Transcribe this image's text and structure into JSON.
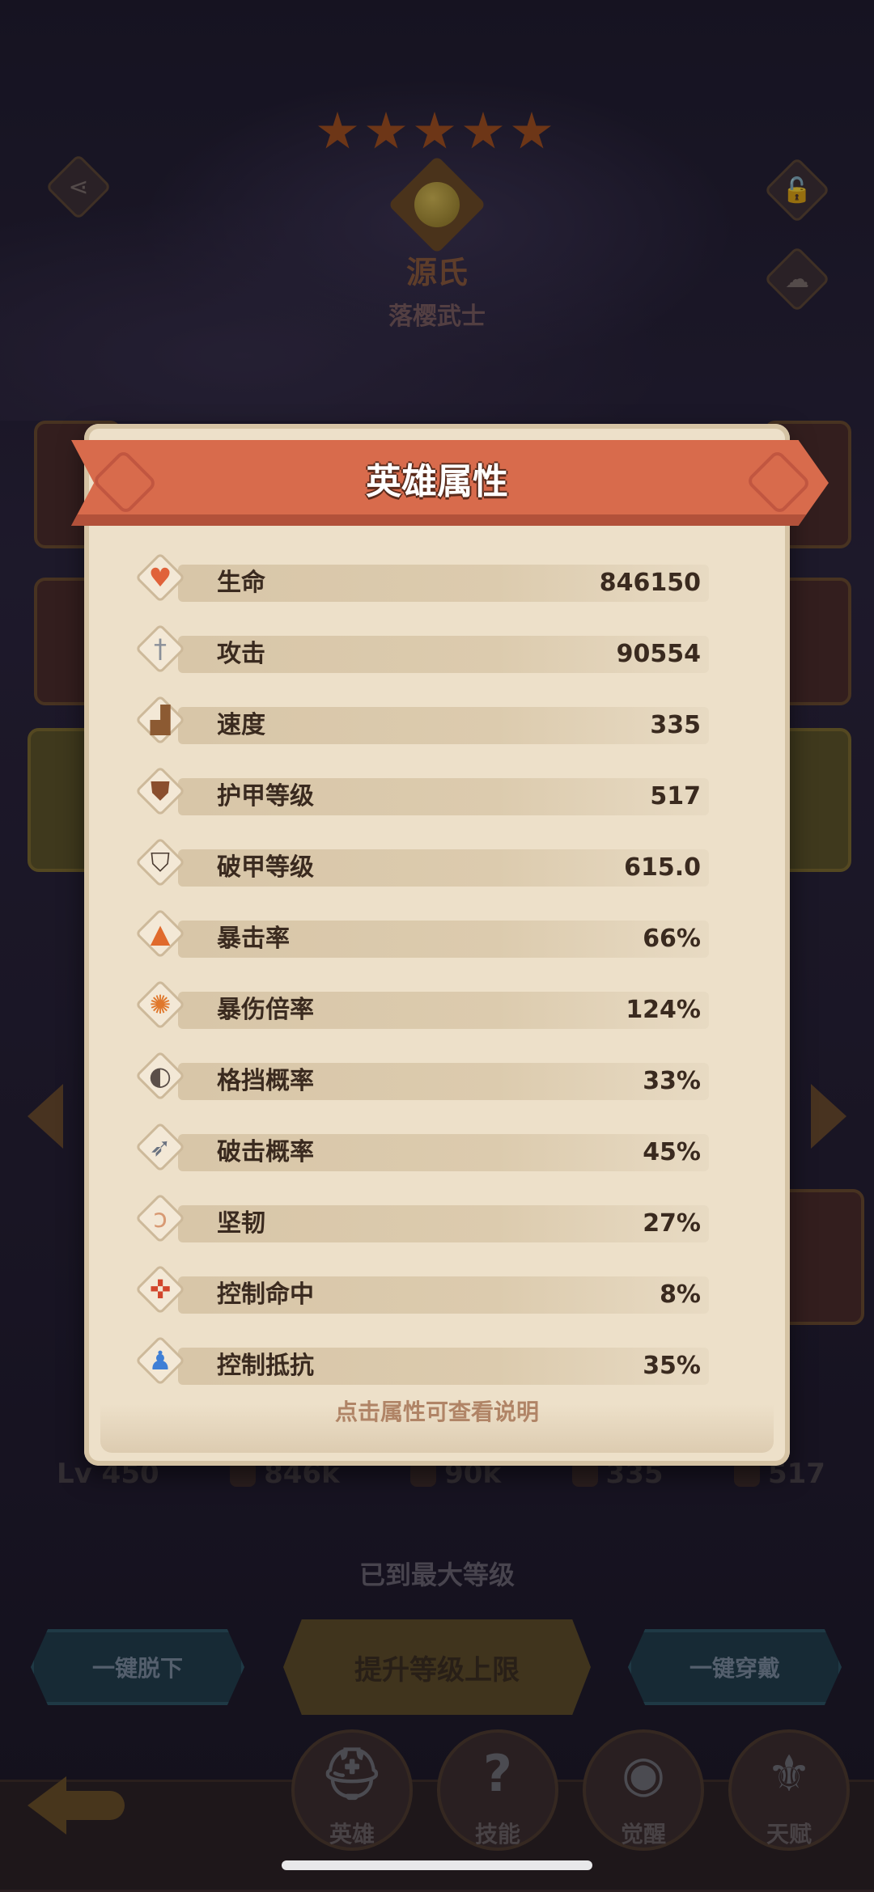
{
  "hero": {
    "name": "源氏",
    "class": "落樱武士",
    "star_count": 5
  },
  "background_stats": [
    {
      "icon": "level-icon",
      "value": "Lv 450"
    },
    {
      "icon": "health-icon",
      "value": "846k"
    },
    {
      "icon": "sword-icon",
      "value": "90k"
    },
    {
      "icon": "speed-icon",
      "value": "335"
    },
    {
      "icon": "shield-icon",
      "value": "517"
    }
  ],
  "status_text": "已到最大等级",
  "actions": {
    "unequip_all": "一键脱下",
    "raise_cap": "提升等级上限",
    "equip_all": "一键穿戴"
  },
  "nav": [
    {
      "label": "英雄",
      "icon": "helmet-icon"
    },
    {
      "label": "技能",
      "icon": "question-icon"
    },
    {
      "label": "觉醒",
      "icon": "eye-icon"
    },
    {
      "label": "天赋",
      "icon": "fleur-icon"
    }
  ],
  "dialog": {
    "title": "英雄属性",
    "hint": "点击属性可查看说明",
    "stats": [
      {
        "name": "生命",
        "value": "846150",
        "icon": "heart-icon"
      },
      {
        "name": "攻击",
        "value": "90554",
        "icon": "sword-icon"
      },
      {
        "name": "速度",
        "value": "335",
        "icon": "boot-icon"
      },
      {
        "name": "护甲等级",
        "value": "517",
        "icon": "shield-icon"
      },
      {
        "name": "破甲等级",
        "value": "615.0",
        "icon": "broken-shield-icon"
      },
      {
        "name": "暴击率",
        "value": "66%",
        "icon": "crit-flame-icon"
      },
      {
        "name": "暴伤倍率",
        "value": "124%",
        "icon": "crit-damage-icon"
      },
      {
        "name": "格挡概率",
        "value": "33%",
        "icon": "block-icon"
      },
      {
        "name": "破击概率",
        "value": "45%",
        "icon": "pierce-icon"
      },
      {
        "name": "坚韧",
        "value": "27%",
        "icon": "muscle-icon"
      },
      {
        "name": "控制命中",
        "value": "8%",
        "icon": "target-icon"
      },
      {
        "name": "控制抵抗",
        "value": "35%",
        "icon": "resist-icon"
      }
    ]
  },
  "colors": {
    "banner": "#d86b4c",
    "parchment": "#ede0c9",
    "stat_text": "#3a2a1f",
    "hint": "#b08466"
  }
}
